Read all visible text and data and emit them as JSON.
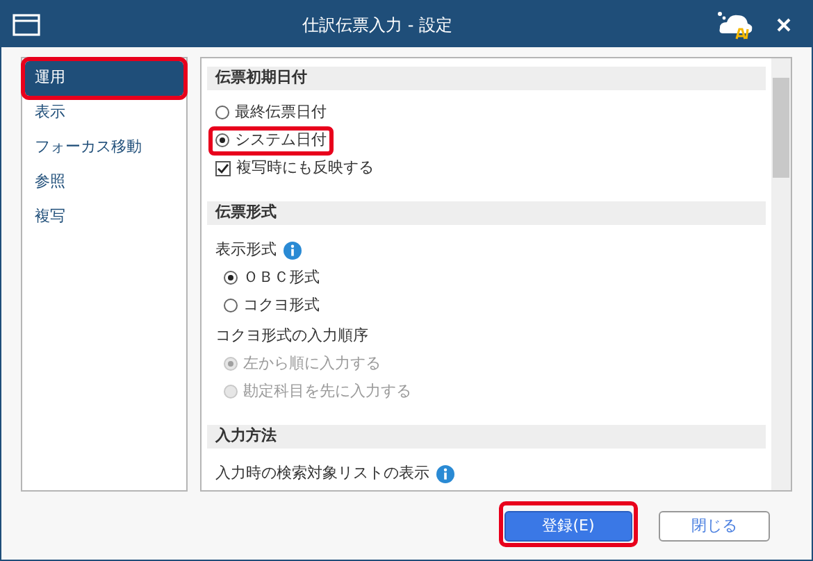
{
  "window": {
    "title": "仕訳伝票入力 - 設定"
  },
  "sidebar": {
    "items": [
      {
        "label": "運用",
        "selected": true,
        "highlighted": true
      },
      {
        "label": "表示",
        "selected": false,
        "highlighted": false
      },
      {
        "label": "フォーカス移動",
        "selected": false,
        "highlighted": false
      },
      {
        "label": "参照",
        "selected": false,
        "highlighted": false
      },
      {
        "label": "複写",
        "selected": false,
        "highlighted": false
      }
    ]
  },
  "sections": [
    {
      "title": "伝票初期日付",
      "items": [
        {
          "kind": "radio",
          "label": "最終伝票日付",
          "selected": false,
          "disabled": false,
          "highlighted": false
        },
        {
          "kind": "radio",
          "label": "システム日付",
          "selected": true,
          "disabled": false,
          "highlighted": true
        },
        {
          "kind": "checkbox",
          "label": "複写時にも反映する",
          "checked": true
        }
      ]
    },
    {
      "title": "伝票形式",
      "items": [
        {
          "kind": "label",
          "label": "表示形式",
          "info": true
        },
        {
          "kind": "radio",
          "label": "ＯＢＣ形式",
          "selected": true,
          "disabled": false,
          "highlighted": false
        },
        {
          "kind": "radio",
          "label": "コクヨ形式",
          "selected": false,
          "disabled": false,
          "highlighted": false
        },
        {
          "kind": "label",
          "label": "コクヨ形式の入力順序",
          "info": false
        },
        {
          "kind": "radio",
          "label": "左から順に入力する",
          "selected": true,
          "disabled": true,
          "highlighted": false
        },
        {
          "kind": "radio",
          "label": "勘定科目を先に入力する",
          "selected": false,
          "disabled": true,
          "highlighted": false
        }
      ]
    },
    {
      "title": "入力方法",
      "items": [
        {
          "kind": "label",
          "label": "入力時の検索対象リストの表示",
          "info": true
        }
      ]
    }
  ],
  "buttons": [
    {
      "label": "登録(E)",
      "primary": true,
      "highlighted": true
    },
    {
      "label": "閉じる",
      "primary": false,
      "highlighted": false
    }
  ]
}
